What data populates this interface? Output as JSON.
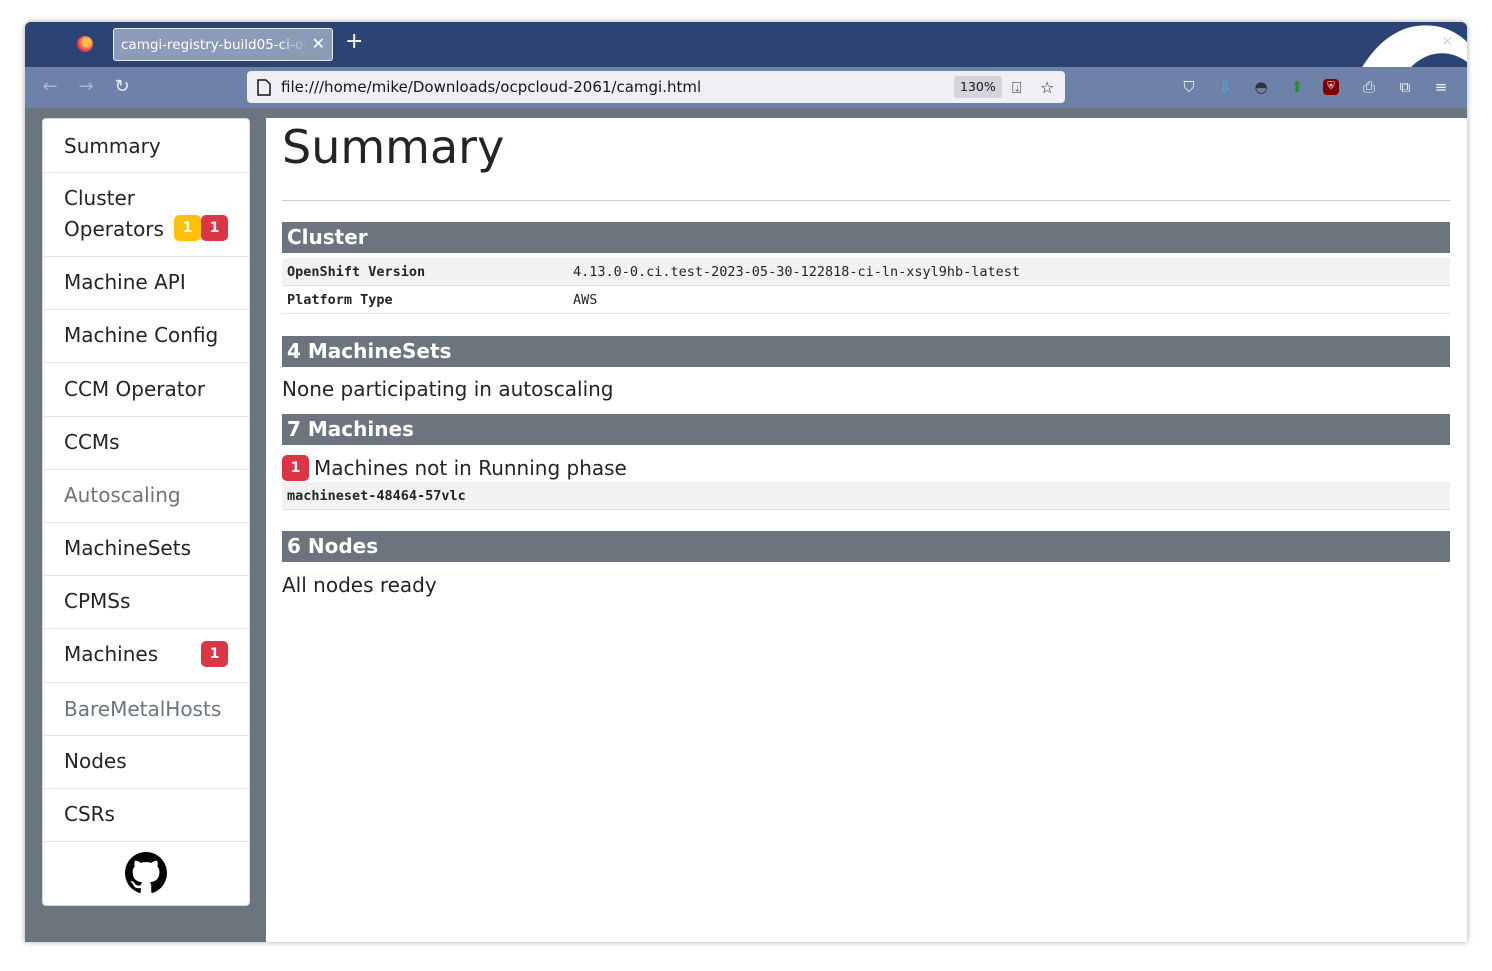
{
  "browser": {
    "tab_title": "camgi-registry-build05-ci-op",
    "url": "file:///home/mike/Downloads/ocpcloud-2061/camgi.html",
    "zoom": "130%"
  },
  "sidebar": {
    "items": [
      {
        "label": "Summary"
      },
      {
        "label": "Cluster Operators",
        "line1": "Cluster",
        "line2": "Operators",
        "badges": [
          "1",
          "1"
        ]
      },
      {
        "label": "Machine API"
      },
      {
        "label": "Machine Config"
      },
      {
        "label": "CCM Operator"
      },
      {
        "label": "CCMs"
      },
      {
        "label": "Autoscaling",
        "muted": true
      },
      {
        "label": "MachineSets"
      },
      {
        "label": "CPMSs"
      },
      {
        "label": "Machines",
        "badges": [
          "1"
        ]
      },
      {
        "label": "BareMetalHosts",
        "muted": true
      },
      {
        "label": "Nodes"
      },
      {
        "label": "CSRs"
      }
    ],
    "footer_icon": "github-icon"
  },
  "main": {
    "title": "Summary",
    "cluster": {
      "heading": "Cluster",
      "rows": [
        {
          "key": "OpenShift Version",
          "value": "4.13.0-0.ci.test-2023-05-30-122818-ci-ln-xsyl9hb-latest"
        },
        {
          "key": "Platform Type",
          "value": "AWS"
        }
      ]
    },
    "machinesets": {
      "heading": "4 MachineSets",
      "text": "None participating in autoscaling"
    },
    "machines": {
      "heading": "7 Machines",
      "badge": "1",
      "text": "Machines not in Running phase",
      "rows": [
        "machineset-48464-57vlc"
      ]
    },
    "nodes": {
      "heading": "6 Nodes",
      "text": "All nodes ready"
    }
  },
  "colors": {
    "badge_red": "#dc3545",
    "badge_yellow": "#ffc107",
    "section_header": "#6c757d",
    "tabstrip": "#2b4474",
    "toolbar": "#6e82a9"
  }
}
